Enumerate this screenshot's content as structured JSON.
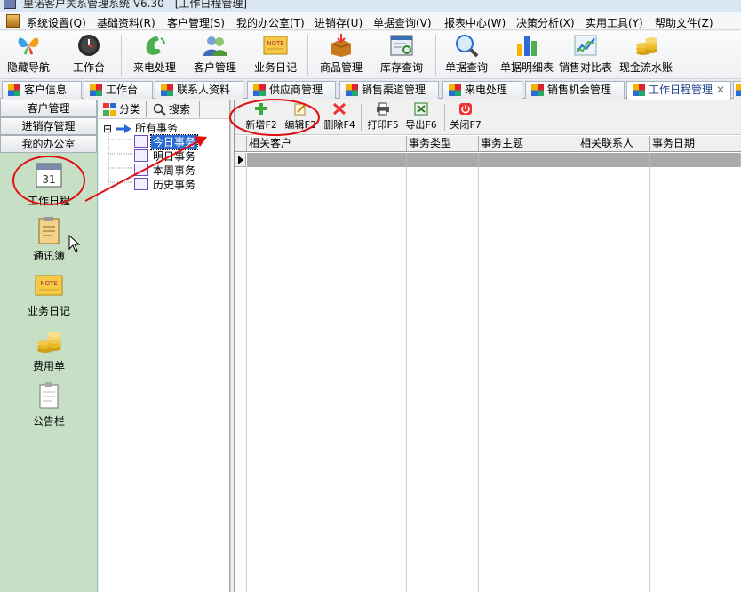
{
  "window": {
    "title": "里诺客户关系管理系统 V6.30 - [工作日程管理]"
  },
  "menu": [
    "系统设置(Q)",
    "基础资料(R)",
    "客户管理(S)",
    "我的办公室(T)",
    "进销存(U)",
    "单据查询(V)",
    "报表中心(W)",
    "决策分析(X)",
    "实用工具(Y)",
    "帮助文件(Z)"
  ],
  "toolbar": [
    {
      "label": "隐藏导航",
      "icon": "butterfly-icon"
    },
    {
      "label": "工作台",
      "icon": "clock-icon"
    },
    {
      "label": "来电处理",
      "icon": "phone-icon"
    },
    {
      "label": "客户管理",
      "icon": "users-icon"
    },
    {
      "label": "业务日记",
      "icon": "note-icon"
    },
    {
      "label": "商品管理",
      "icon": "box-icon"
    },
    {
      "label": "库存查询",
      "icon": "inventory-icon"
    },
    {
      "label": "单据查询",
      "icon": "magnifier-icon"
    },
    {
      "label": "单据明细表",
      "icon": "bar-chart-icon"
    },
    {
      "label": "销售对比表",
      "icon": "line-chart-icon"
    },
    {
      "label": "现金流水账",
      "icon": "coins-icon"
    }
  ],
  "note_icon_text": "NOTE",
  "tabs": [
    "客户信息",
    "工作台",
    "联系人资料",
    "供应商管理",
    "销售渠道管理",
    "来电处理",
    "销售机会管理",
    "工作日程管理"
  ],
  "tab_close": "✕",
  "nav": {
    "headers": [
      "客户管理",
      "进销存管理",
      "我的办公室"
    ],
    "calendar_day": "31",
    "items": [
      "工作日程",
      "通讯簿",
      "业务日记",
      "费用单",
      "公告栏"
    ]
  },
  "tree_tabs": [
    "分类",
    "搜索"
  ],
  "tree": {
    "root": "所有事务",
    "expander": "⊟",
    "children": [
      "今日事务",
      "明日事务",
      "本周事务",
      "历史事务"
    ],
    "selected": "今日事务"
  },
  "actions": [
    "新增F2",
    "编辑F3",
    "删除F4",
    "打印F5",
    "导出F6",
    "关闭F7"
  ],
  "grid": {
    "columns": [
      "相关客户",
      "事务类型",
      "事务主题",
      "相关联系人",
      "事务日期"
    ]
  },
  "colors": {
    "nav_bg": "#c6dfc5",
    "annotation": "#e01010",
    "selected": "#2b6bd6"
  }
}
